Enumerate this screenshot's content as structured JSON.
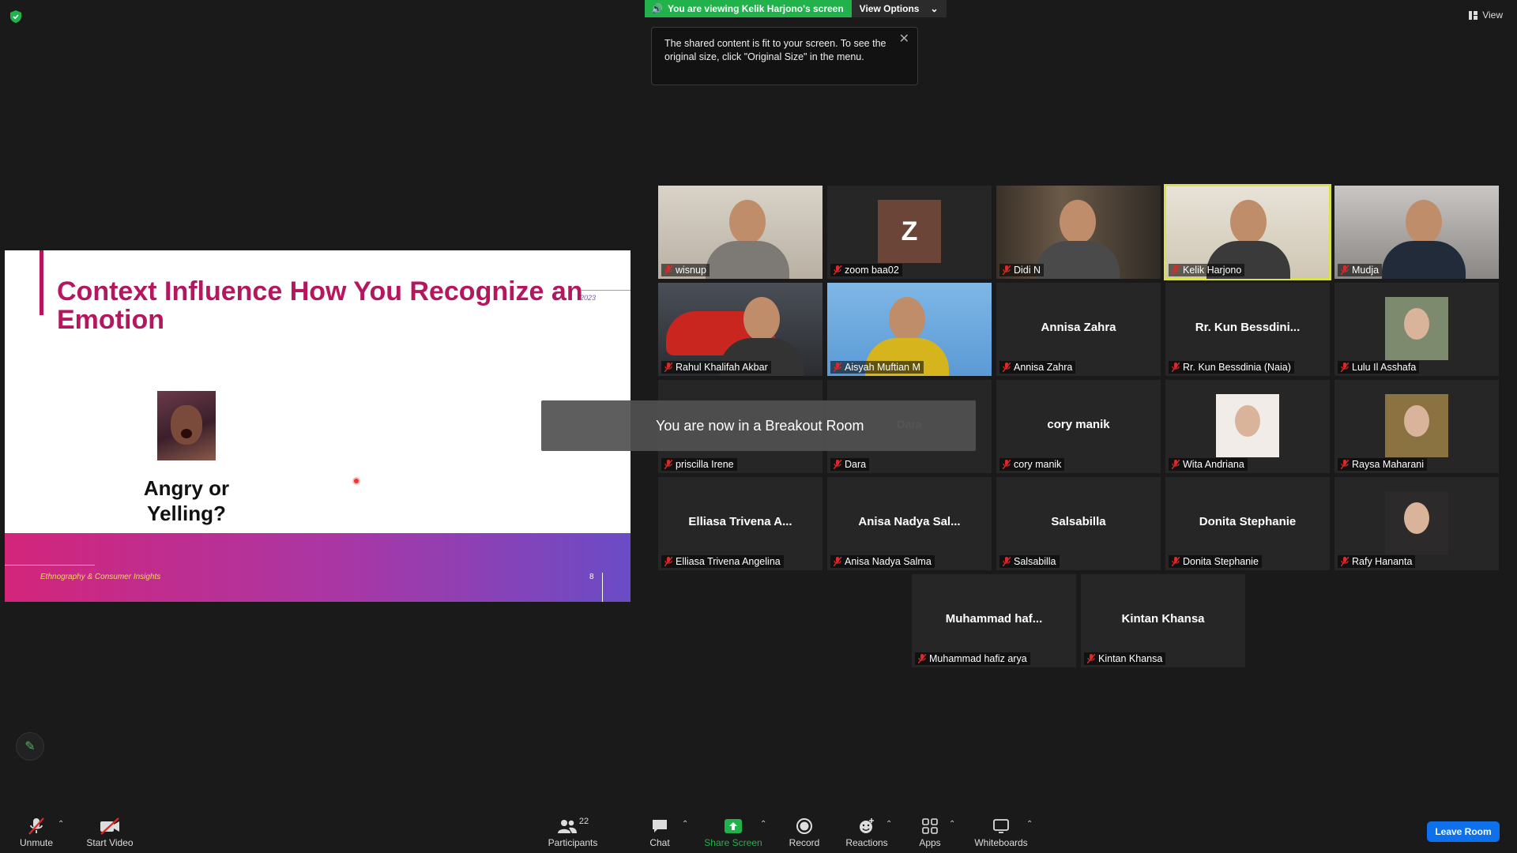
{
  "share_banner": {
    "status": "You are viewing Kelik Harjono's screen",
    "view_options": "View Options"
  },
  "view_button": "View",
  "tooltip": {
    "text": "The shared content is fit to your screen. To see the original size, click \"Original Size\" in the menu."
  },
  "slide": {
    "title": "Context Influence How You Recognize an Emotion",
    "year": "2023",
    "question": "Angry or Yelling?",
    "footer_text": "Ethnography & Consumer Insights",
    "page_number": "8"
  },
  "breakout": {
    "message": "You are now in a Breakout Room"
  },
  "participants": [
    {
      "name": "wisnup",
      "big": ""
    },
    {
      "name": "zoom baa02",
      "big": "Z"
    },
    {
      "name": "Didi N",
      "big": ""
    },
    {
      "name": "Kelik Harjono",
      "big": ""
    },
    {
      "name": "Mudja",
      "big": ""
    },
    {
      "name": "Rahul Khalifah Akbar",
      "big": ""
    },
    {
      "name": "Aisyah Muftian M",
      "big": ""
    },
    {
      "name": "Annisa Zahra",
      "big": "Annisa Zahra"
    },
    {
      "name": "Rr. Kun Bessdinia (Naia)",
      "big": "Rr. Kun Bessdini..."
    },
    {
      "name": "Lulu Il Asshafa",
      "big": ""
    },
    {
      "name": "priscilla Irene",
      "big": ""
    },
    {
      "name": "Dara",
      "big": "Dara"
    },
    {
      "name": "cory manik",
      "big": "cory manik"
    },
    {
      "name": "Wita Andriana",
      "big": ""
    },
    {
      "name": "Raysa Maharani",
      "big": ""
    },
    {
      "name": "Elliasa Trivena Angelina",
      "big": "Elliasa Trivena A..."
    },
    {
      "name": "Anisa Nadya Salma",
      "big": "Anisa Nadya Sal..."
    },
    {
      "name": "Salsabilla",
      "big": "Salsabilla"
    },
    {
      "name": "Donita Stephanie",
      "big": "Donita Stephanie"
    },
    {
      "name": "Rafy Hananta",
      "big": ""
    },
    {
      "name": "Muhammad hafiz arya",
      "big": "Muhammad haf..."
    },
    {
      "name": "Kintan Khansa",
      "big": "Kintan Khansa"
    }
  ],
  "toolbar": {
    "unmute": "Unmute",
    "start_video": "Start Video",
    "participants": "Participants",
    "participants_count": "22",
    "chat": "Chat",
    "share_screen": "Share Screen",
    "record": "Record",
    "reactions": "Reactions",
    "apps": "Apps",
    "whiteboards": "Whiteboards",
    "leave_room": "Leave Room"
  },
  "colors": {
    "accent_green": "#22b24c",
    "slide_title": "#b5175e",
    "leave_blue": "#0e71eb",
    "active_speaker": "#d9e24a"
  }
}
